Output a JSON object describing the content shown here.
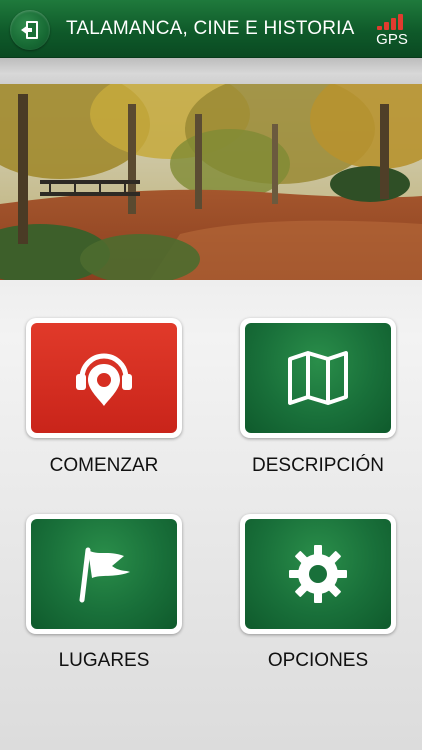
{
  "header": {
    "title": "TALAMANCA, CINE E HISTORIA",
    "gps_label": "GPS",
    "exit_icon": "exit-door-icon",
    "gps_signal_color": "#e23b2f"
  },
  "hero": {
    "icon": "autumn-park-photo"
  },
  "menu": {
    "comenzar": {
      "label": "COMENZAR",
      "icon": "audio-guide-pin-icon",
      "color": "#d62e22"
    },
    "descripcion": {
      "label": "DESCRIPCIÓN",
      "icon": "map-icon",
      "color": "#19703a"
    },
    "lugares": {
      "label": "LUGARES",
      "icon": "flag-icon",
      "color": "#19703a"
    },
    "opciones": {
      "label": "OPCIONES",
      "icon": "gear-icon",
      "color": "#19703a"
    }
  }
}
